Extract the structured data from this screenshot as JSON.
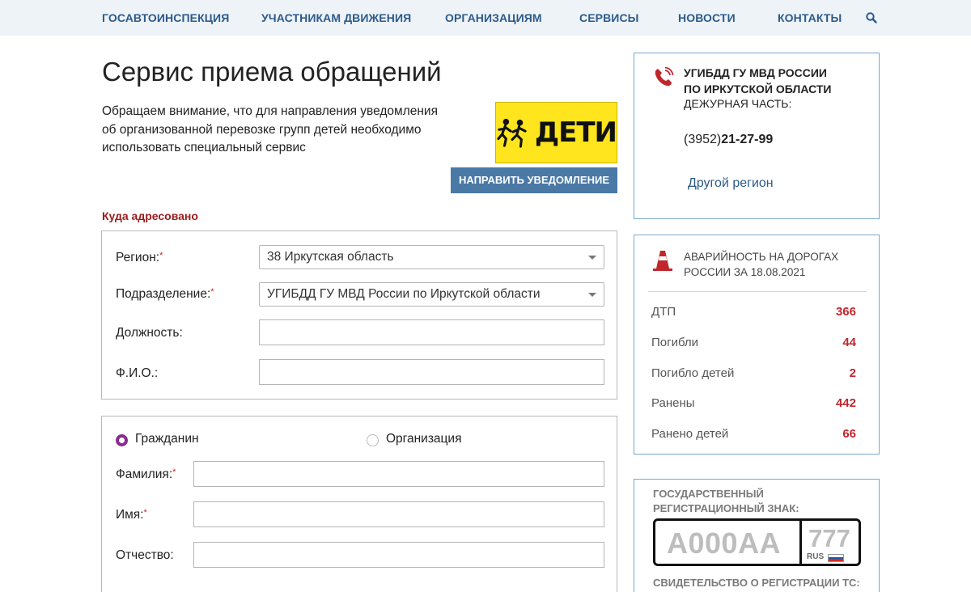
{
  "nav": {
    "items": [
      "ГОСАВТОИНСПЕКЦИЯ",
      "УЧАСТНИКАМ ДВИЖЕНИЯ",
      "ОРГАНИЗАЦИЯМ",
      "СЕРВИСЫ",
      "НОВОСТИ",
      "КОНТАКТЫ"
    ],
    "search_icon": "search-icon"
  },
  "page": {
    "title": "Сервис приема обращений",
    "notice": "Обращаем внимание, что для направления уведомления об организованной перевозке групп детей необходимо использовать специальный сервис",
    "deti_logo_text": "ДЕТИ",
    "notify_button": "НАПРАВИТЬ УВЕДОМЛЕНИЕ"
  },
  "addressed": {
    "section_label": "Куда адресовано",
    "region_label": "Регион:",
    "region_value": "38 Иркутская область",
    "division_label": "Подразделение:",
    "division_value": "УГИБДД ГУ МВД России по Иркутской области",
    "position_label": "Должность:",
    "position_value": "",
    "fio_label": "Ф.И.О.:",
    "fio_value": "",
    "required_mark": "*"
  },
  "applicant": {
    "options": [
      {
        "label": "Гражданин",
        "selected": true
      },
      {
        "label": "Организация",
        "selected": false
      }
    ],
    "surname_label": "Фамилия:",
    "surname_value": "",
    "name_label": "Имя:",
    "name_value": "",
    "patronymic_label": "Отчество:",
    "patronymic_value": ""
  },
  "contact_panel": {
    "icon": "phone-icon",
    "office": "УГИБДД ГУ МВД РОССИИ ПО ИРКУТСКОЙ ОБЛАСТИ",
    "duty": "ДЕЖУРНАЯ ЧАСТЬ:",
    "phone_code": "(3952)",
    "phone_number": "21-27-99",
    "other_region": "Другой регион"
  },
  "accidents_panel": {
    "icon": "traffic-cone-icon",
    "title": "АВАРИЙНОСТЬ НА ДОРОГАХ РОССИИ ЗА 18.08.2021",
    "stats": [
      {
        "name": "ДТП",
        "value": "366"
      },
      {
        "name": "Погибли",
        "value": "44"
      },
      {
        "name": "Погибло детей",
        "value": "2"
      },
      {
        "name": "Ранены",
        "value": "442"
      },
      {
        "name": "Ранено детей",
        "value": "66"
      }
    ],
    "value_color": "#c0272d"
  },
  "plate_panel": {
    "title": "ГОСУДАРСТВЕННЫЙ РЕГИСТРАЦИОННЫЙ ЗНАК:",
    "plate_number": "А000АА",
    "plate_region": "777",
    "plate_country": "RUS",
    "certificate_title": "СВИДЕТЕЛЬСТВО О РЕГИСТРАЦИИ ТС:"
  },
  "colors": {
    "nav_bg": "#eef3f8",
    "nav_text": "#2c5a8a",
    "accent_button": "#4a79a6",
    "section_label": "#9b1c1c",
    "panel_border": "#7aa7cf",
    "radio_selected": "#8a2c8f"
  }
}
